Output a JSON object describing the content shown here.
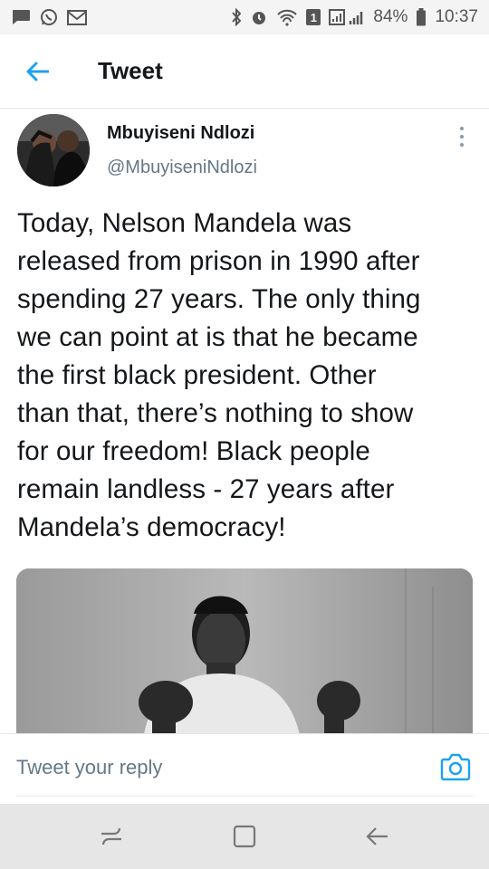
{
  "status_bar": {
    "battery_percent": "84%",
    "time": "10:37",
    "sim_badge": "1",
    "icons": [
      "chat-bubble-icon",
      "whatsapp-icon",
      "gmail-icon",
      "bluetooth-icon",
      "alarm-icon",
      "wifi-icon",
      "signal-icon",
      "battery-icon"
    ]
  },
  "header": {
    "title": "Tweet"
  },
  "tweet": {
    "author_name": "Mbuyiseni Ndlozi",
    "author_handle": "@MbuyiseniNdlozi",
    "text": "Today, Nelson Mandela was\nreleased from prison in 1990 after\nspending 27 years. The only thing\nwe can point at is that he became\nthe first black president. Other\nthan that, there’s nothing to show\nfor our freedom! Black people\nremain landless - 27 years after\nMandela’s democracy!"
  },
  "reply": {
    "placeholder": "Tweet your reply"
  },
  "colors": {
    "accent": "#1da1f2",
    "text": "#14171a",
    "secondary_text": "#657786"
  }
}
